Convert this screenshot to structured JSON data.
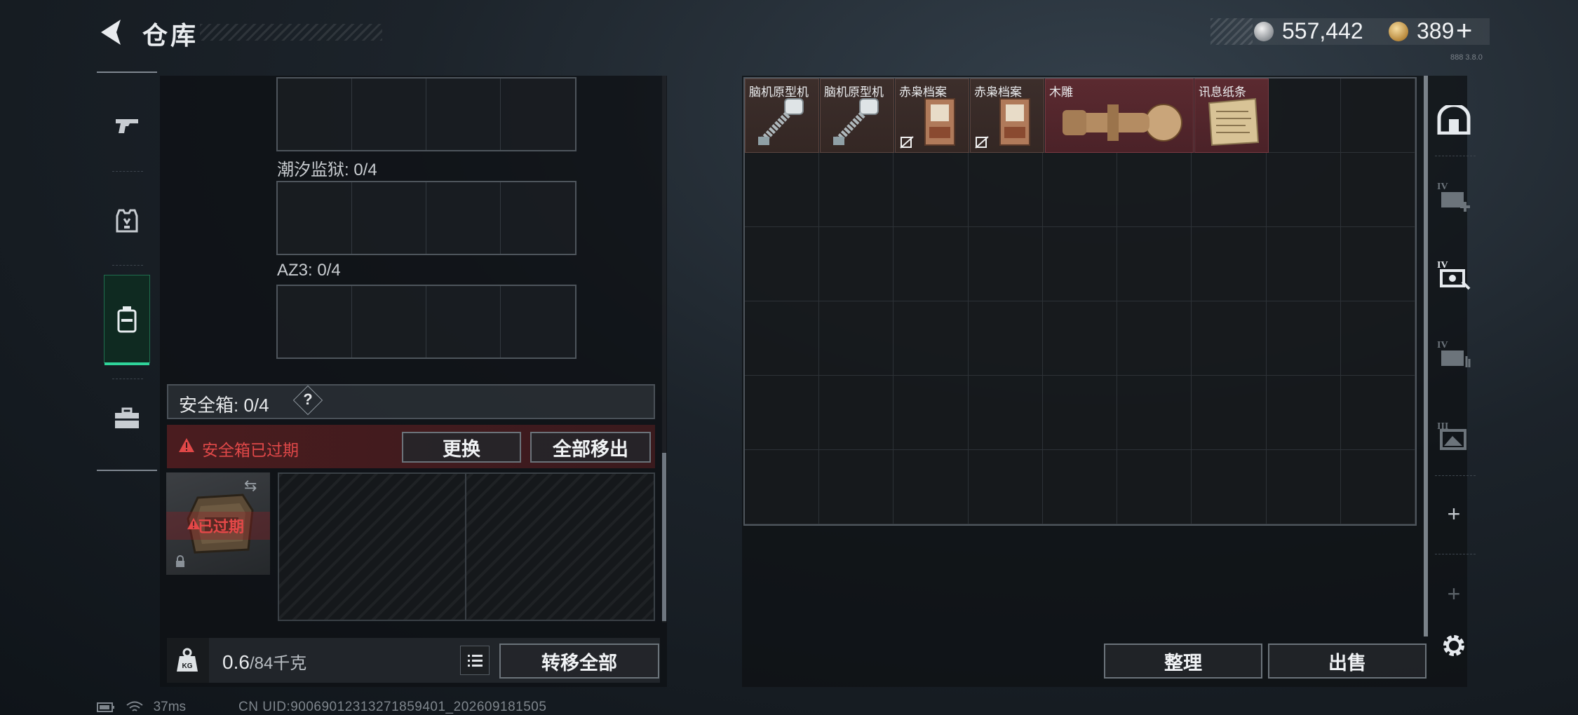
{
  "header": {
    "title": "仓库",
    "currency": [
      {
        "type": "silver-coin",
        "value": "557,442"
      },
      {
        "type": "gold-coin",
        "value": "389"
      }
    ],
    "add_label": "+",
    "build": "888 3.8.0"
  },
  "left_tabs": [
    {
      "icon": "pistol-icon",
      "active": false
    },
    {
      "icon": "armor-vest-icon",
      "active": false
    },
    {
      "icon": "backpack-icon",
      "active": true
    },
    {
      "icon": "toolbox-icon",
      "active": false
    }
  ],
  "containers": [
    {
      "label": "潮汐监狱: 0/4"
    },
    {
      "label": "AZ3: 0/4"
    }
  ],
  "safebox": {
    "title": "安全箱: 0/4",
    "help": "?",
    "expired_warning": "安全箱已过期",
    "replace_label": "更换",
    "move_all_label": "全部移出",
    "case_expired_badge": "已过期",
    "case_swap": "⇆"
  },
  "footer_left": {
    "weight_value": "0.6",
    "weight_max": "/84千克",
    "weight_icon_label": "KG",
    "transfer_all_label": "转移全部"
  },
  "stash": {
    "items": [
      {
        "name": "脑机原型机",
        "rarity": "purple",
        "nontrade": false
      },
      {
        "name": "脑机原型机",
        "rarity": "purple",
        "nontrade": false
      },
      {
        "name": "赤枭档案",
        "rarity": "purple",
        "nontrade": true
      },
      {
        "name": "赤枭档案",
        "rarity": "purple",
        "nontrade": true
      },
      {
        "name": "木雕",
        "rarity": "red",
        "nontrade": false
      },
      {
        "name": "讯息纸条",
        "rarity": "red",
        "nontrade": false
      }
    ],
    "sort_label": "整理",
    "sell_label": "出售"
  },
  "right_tabs": [
    {
      "icon": "stash-home-icon"
    },
    {
      "icon": "stash-page-iv-add-icon",
      "level": "IV"
    },
    {
      "icon": "stash-page-iv-edit-icon",
      "level": "IV"
    },
    {
      "icon": "stash-page-iv-list-icon",
      "level": "IV"
    },
    {
      "icon": "stash-page-iii-image-icon",
      "level": "III"
    },
    {
      "icon": "add-page-icon",
      "label": "+"
    },
    {
      "icon": "add-page-disabled-icon",
      "label": "+"
    },
    {
      "icon": "settings-gear-icon"
    }
  ],
  "status_bar": {
    "ping": "37ms",
    "uid": "CN UID:9006901231327185940​1_202609181505"
  }
}
